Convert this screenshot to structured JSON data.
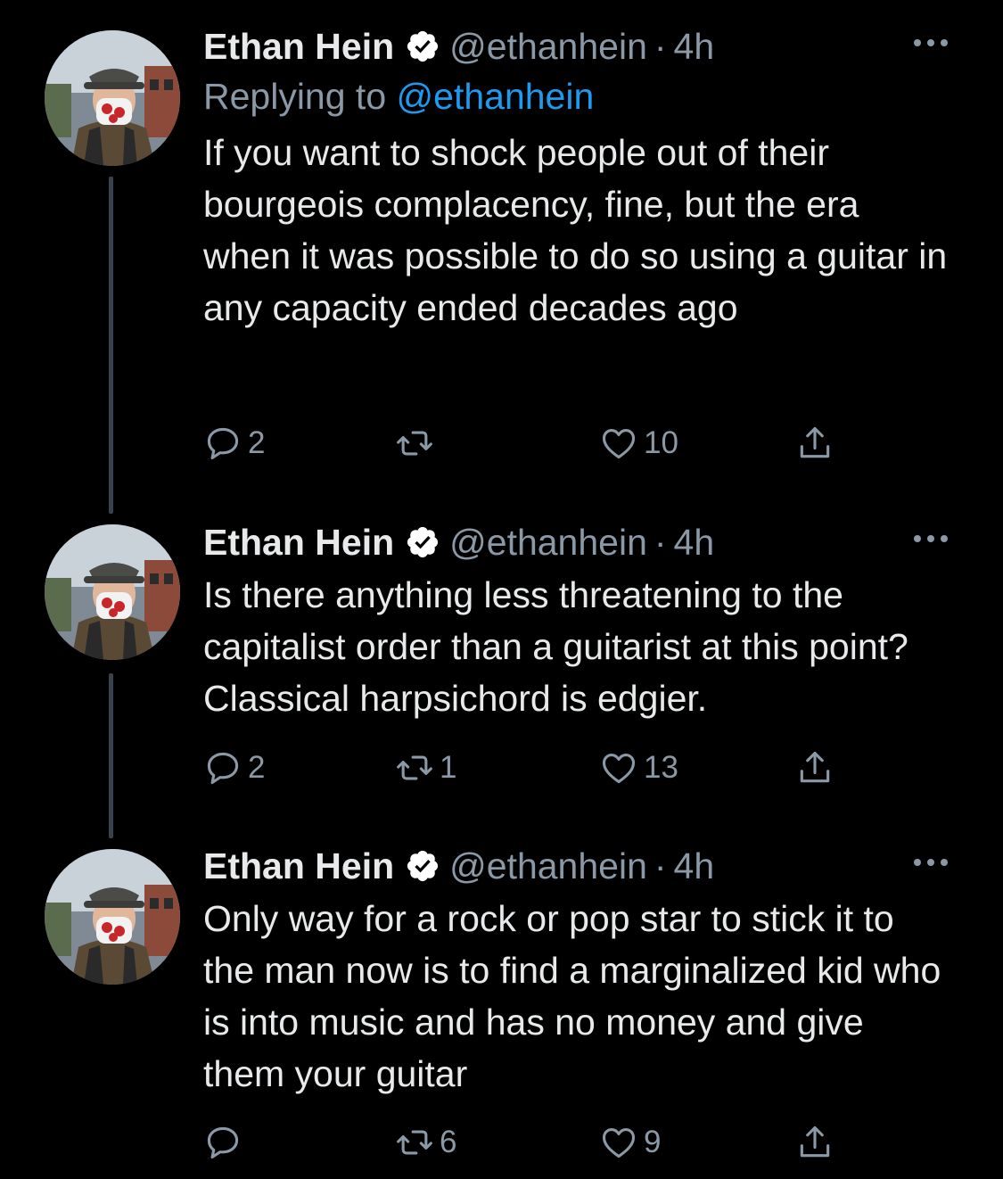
{
  "tweets": [
    {
      "name": "Ethan Hein",
      "handle": "@ethanhein",
      "separator": "·",
      "time": "4h",
      "replying_prefix": "Replying to",
      "replying_handle": "@ethanhein",
      "text": "If you want to shock people out of their bourgeois complacency, fine, but the era when it was possible to do so using a guitar in any capacity ended decades ago",
      "replies": "2",
      "retweets": "",
      "likes": "10"
    },
    {
      "name": "Ethan Hein",
      "handle": "@ethanhein",
      "separator": "·",
      "time": "4h",
      "text": "Is there anything less threatening to the capitalist order than a guitarist at this point? Classical harpsichord is edgier.",
      "replies": "2",
      "retweets": "1",
      "likes": "13"
    },
    {
      "name": "Ethan Hein",
      "handle": "@ethanhein",
      "separator": "·",
      "time": "4h",
      "text": "Only way for a rock or pop star to stick it to the man now is to find a marginalized kid who is into music and has no money and give them your guitar",
      "replies": "",
      "retweets": "6",
      "likes": "9"
    }
  ],
  "icons": [
    "verified-badge-icon",
    "more-icon",
    "reply-icon",
    "retweet-icon",
    "like-icon",
    "share-icon"
  ],
  "colors": {
    "background": "#000000",
    "text": "#e7e9ea",
    "secondary": "#8b98a5",
    "link": "#1d9bf0",
    "thread_line": "#38444d"
  }
}
